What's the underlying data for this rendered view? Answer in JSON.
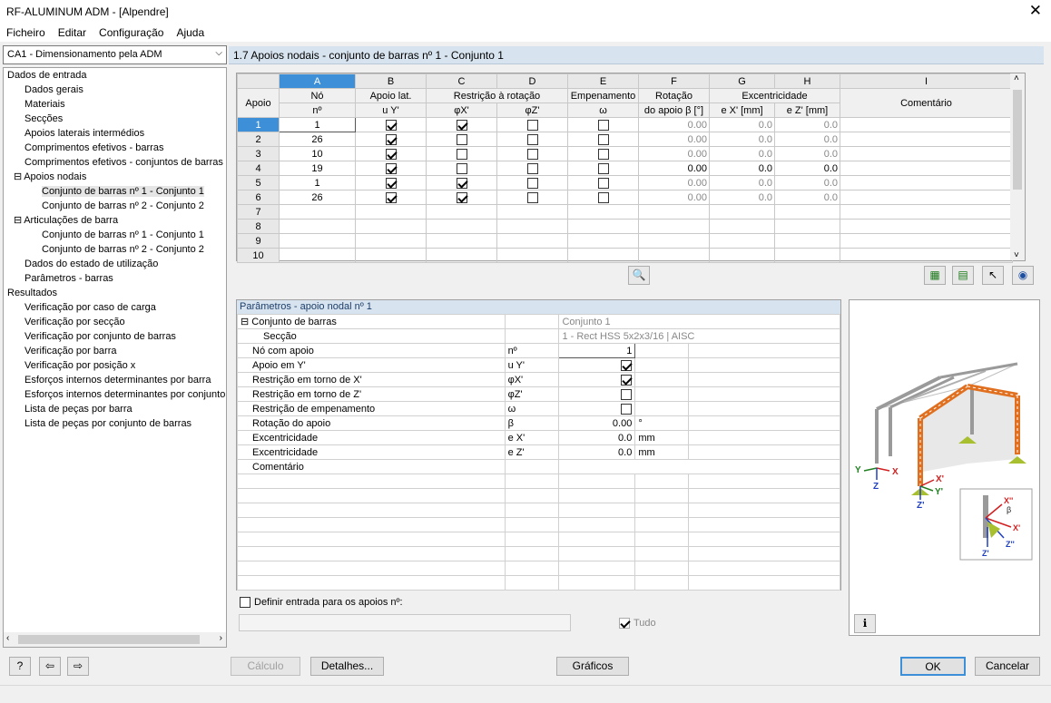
{
  "window": {
    "title": "RF-ALUMINUM ADM - [Alpendre]",
    "close": "✕"
  },
  "menu": [
    "Ficheiro",
    "Editar",
    "Configuração",
    "Ajuda"
  ],
  "case_select": "CA1 - Dimensionamento pela ADM",
  "tree": [
    {
      "label": "Dados de entrada",
      "lvl": 0
    },
    {
      "label": "Dados gerais",
      "lvl": 1
    },
    {
      "label": "Materiais",
      "lvl": 1
    },
    {
      "label": "Secções",
      "lvl": 1
    },
    {
      "label": "Apoios laterais intermédios",
      "lvl": 1
    },
    {
      "label": "Comprimentos efetivos - barras",
      "lvl": 1
    },
    {
      "label": "Comprimentos efetivos - conjuntos de barras",
      "lvl": 1
    },
    {
      "label": "Apoios nodais",
      "lvl": 1,
      "exp": true
    },
    {
      "label": "Conjunto de barras nº 1 - Conjunto 1",
      "lvl": 2,
      "sel": true
    },
    {
      "label": "Conjunto de barras nº 2 - Conjunto 2",
      "lvl": 2
    },
    {
      "label": "Articulações de barra",
      "lvl": 1,
      "exp": true
    },
    {
      "label": "Conjunto de barras nº 1 - Conjunto 1",
      "lvl": 2
    },
    {
      "label": "Conjunto de barras nº 2 - Conjunto 2",
      "lvl": 2
    },
    {
      "label": "Dados do estado de utilização",
      "lvl": 1
    },
    {
      "label": "Parâmetros - barras",
      "lvl": 1
    },
    {
      "label": "Resultados",
      "lvl": 0
    },
    {
      "label": "Verificação por caso de carga",
      "lvl": 1
    },
    {
      "label": "Verificação por secção",
      "lvl": 1
    },
    {
      "label": "Verificação por conjunto de barras",
      "lvl": 1
    },
    {
      "label": "Verificação por barra",
      "lvl": 1
    },
    {
      "label": "Verificação por posição x",
      "lvl": 1
    },
    {
      "label": "Esforços internos determinantes por barra",
      "lvl": 1
    },
    {
      "label": "Esforços internos determinantes por conjunto",
      "lvl": 1
    },
    {
      "label": "Lista de peças por barra",
      "lvl": 1
    },
    {
      "label": "Lista de peças por conjunto de barras",
      "lvl": 1
    }
  ],
  "section_title": "1.7 Apoios nodais - conjunto de barras nº 1 - Conjunto 1",
  "grid": {
    "col_letters": [
      "A",
      "B",
      "C",
      "D",
      "E",
      "F",
      "G",
      "H",
      "I"
    ],
    "h1": {
      "apoio": "Apoio",
      "no": "Nó",
      "apoio_lat": "Apoio lat.",
      "restr": "Restrição à rotação",
      "emp": "Empenamento",
      "rot": "Rotação",
      "exc": "Excentricidade",
      "com": "Comentário"
    },
    "h2": {
      "apoio": "nº",
      "no": "nº",
      "uy": "u Y'",
      "phix": "φX'",
      "phiz": "φZ'",
      "omega": "ω",
      "beta": "do apoio β [°]",
      "ex": "e X' [mm]",
      "ez": "e Z' [mm]"
    },
    "rows": [
      {
        "n": "1",
        "no": "1",
        "uy": true,
        "px": true,
        "pz": false,
        "w": false,
        "b": "0.00",
        "ex": "0.0",
        "ez": "0.0",
        "g": true
      },
      {
        "n": "2",
        "no": "26",
        "uy": true,
        "px": false,
        "pz": false,
        "w": false,
        "b": "0.00",
        "ex": "0.0",
        "ez": "0.0",
        "g": true
      },
      {
        "n": "3",
        "no": "10",
        "uy": true,
        "px": false,
        "pz": false,
        "w": false,
        "b": "0.00",
        "ex": "0.0",
        "ez": "0.0",
        "g": true
      },
      {
        "n": "4",
        "no": "19",
        "uy": true,
        "px": false,
        "pz": false,
        "w": false,
        "b": "0.00",
        "ex": "0.0",
        "ez": "0.0",
        "g": false
      },
      {
        "n": "5",
        "no": "1",
        "uy": true,
        "px": true,
        "pz": false,
        "w": false,
        "b": "0.00",
        "ex": "0.0",
        "ez": "0.0",
        "g": true
      },
      {
        "n": "6",
        "no": "26",
        "uy": true,
        "px": true,
        "pz": false,
        "w": false,
        "b": "0.00",
        "ex": "0.0",
        "ez": "0.0",
        "g": true
      },
      {
        "n": "7"
      },
      {
        "n": "8"
      },
      {
        "n": "9"
      },
      {
        "n": "10"
      }
    ]
  },
  "params": {
    "title": "Parâmetros - apoio nodal nº 1",
    "rows": [
      {
        "label": "Conjunto de barras",
        "sym": "",
        "val": "Conjunto 1",
        "unit": "",
        "type": "head"
      },
      {
        "label": "Secção",
        "sym": "",
        "val": "1 - Rect HSS 5x2x3/16 | AISC",
        "unit": "",
        "type": "sub"
      },
      {
        "label": "Nó com apoio",
        "sym": "nº",
        "val": "1",
        "unit": "",
        "type": "num"
      },
      {
        "label": "Apoio em Y'",
        "sym": "u Y'",
        "val": true,
        "unit": "",
        "type": "cb"
      },
      {
        "label": "Restrição em torno de X'",
        "sym": "φX'",
        "val": true,
        "unit": "",
        "type": "cb"
      },
      {
        "label": "Restrição em torno de Z'",
        "sym": "φZ'",
        "val": false,
        "unit": "",
        "type": "cb"
      },
      {
        "label": "Restrição de empenamento",
        "sym": "ω",
        "val": false,
        "unit": "",
        "type": "cb"
      },
      {
        "label": "Rotação do apoio",
        "sym": "β",
        "val": "0.00",
        "unit": "°",
        "type": "num"
      },
      {
        "label": "Excentricidade",
        "sym": "e X'",
        "val": "0.0",
        "unit": "mm",
        "type": "num"
      },
      {
        "label": "Excentricidade",
        "sym": "e Z'",
        "val": "0.0",
        "unit": "mm",
        "type": "num"
      },
      {
        "label": "Comentário",
        "sym": "",
        "val": "",
        "unit": "",
        "type": "wide"
      }
    ],
    "define_label": "Definir entrada para os apoios nº:",
    "all_label": "Tudo"
  },
  "preview": {
    "axes": {
      "y": "Y",
      "x": "X",
      "z": "Z",
      "x1": "X'",
      "y1": "Y'",
      "z1": "Z'",
      "x2": "X''",
      "z2": "Z''",
      "beta": "β"
    }
  },
  "buttons": {
    "calc": "Cálculo",
    "details": "Detalhes...",
    "graphics": "Gráficos",
    "ok": "OK",
    "cancel": "Cancelar"
  }
}
